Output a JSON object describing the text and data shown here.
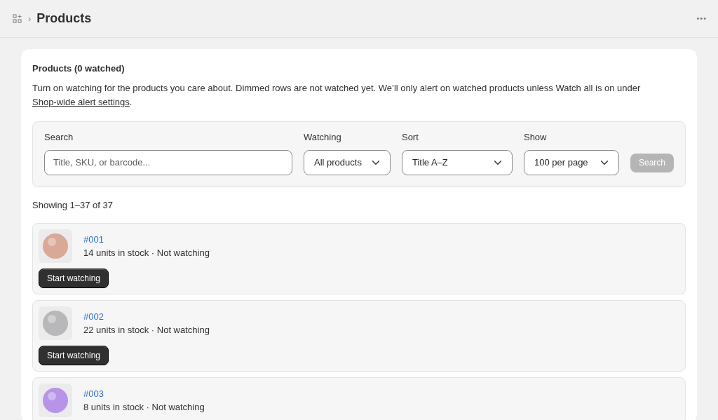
{
  "header": {
    "breadcrumb_separator": "›",
    "title": "Products",
    "menu": "•••"
  },
  "card": {
    "heading": "Products (0 watched)",
    "description": "Turn on watching for the products you care about. Dimmed rows are not watched yet. We’ll only alert on watched products unless Watch all is on under ",
    "link": "Shop-wide alert settings",
    "after_link": "."
  },
  "filters": {
    "search": {
      "label": "Search",
      "placeholder": "Title, SKU, or barcode..."
    },
    "selects": [
      {
        "label": "Watching",
        "value": "All products"
      },
      {
        "label": "Sort",
        "value": "Title A–Z"
      },
      {
        "label": "Show",
        "value": "100 per page"
      }
    ],
    "button": {
      "label": "Search",
      "disabled": true
    }
  },
  "summary": "Showing 1–37 of 37",
  "products": [
    {
      "title": "#001",
      "status": "14 units in stock · Not watching",
      "color": "#d9a897",
      "action": "Start watching"
    },
    {
      "title": "#002",
      "status": "22 units in stock · Not watching",
      "color": "#b8b8bb",
      "action": "Start watching"
    },
    {
      "title": "#003",
      "status": "8 units in stock · Not watching",
      "color": "#b794e8"
    }
  ]
}
